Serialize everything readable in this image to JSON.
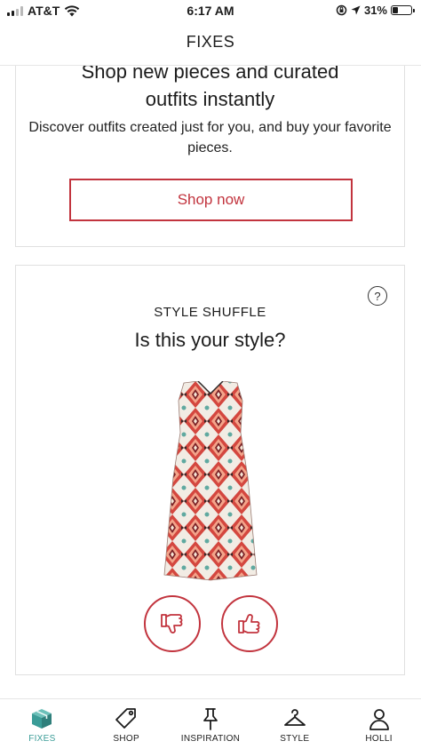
{
  "status_bar": {
    "carrier": "AT&T",
    "time": "6:17 AM",
    "battery_percent": "31%",
    "battery_level": 0.31,
    "icons": [
      "signal-icon",
      "wifi-icon",
      "orientation-lock-icon",
      "location-arrow-icon",
      "battery-icon"
    ]
  },
  "header": {
    "title": "FIXES"
  },
  "shop_card": {
    "heading_line1": "Shop new pieces and curated",
    "heading_line2": "outfits instantly",
    "description": "Discover outfits created just for you, and buy your favorite pieces.",
    "button_label": "Shop now"
  },
  "style_shuffle": {
    "help_symbol": "?",
    "eyebrow": "STYLE SHUFFLE",
    "question": "Is this your style?",
    "image_icon": "patterned-dress-image",
    "buttons": [
      "thumbs-down-icon",
      "thumbs-up-icon"
    ]
  },
  "tab_bar": {
    "active_index": 0,
    "tabs": [
      {
        "label": "FIXES",
        "icon": "box-icon"
      },
      {
        "label": "SHOP",
        "icon": "tag-icon"
      },
      {
        "label": "INSPIRATION",
        "icon": "pin-icon"
      },
      {
        "label": "STYLE",
        "icon": "hanger-icon"
      },
      {
        "label": "HOLLI",
        "icon": "person-icon"
      }
    ]
  },
  "colors": {
    "accent": "#c2343e",
    "active_tab": "#3a9c97",
    "text": "#1c1c1c",
    "border": "#e0e0e0"
  }
}
